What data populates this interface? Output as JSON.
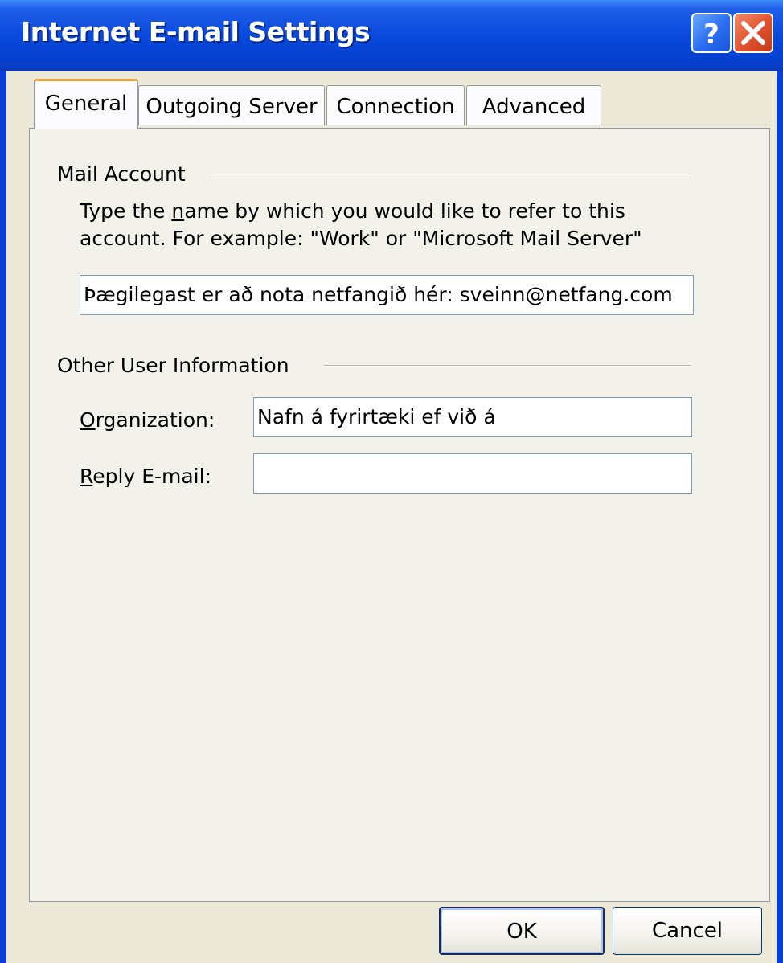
{
  "window": {
    "title": "Internet E-mail Settings",
    "help_icon": "question-mark-icon",
    "close_icon": "close-x-icon"
  },
  "tabs": [
    {
      "label": "General",
      "active": true
    },
    {
      "label": "Outgoing Server",
      "active": false
    },
    {
      "label": "Connection",
      "active": false
    },
    {
      "label": "Advanced",
      "active": false
    }
  ],
  "mail_account": {
    "group_title": "Mail Account",
    "description_line1_pre": "Type the ",
    "description_line1_accel": "n",
    "description_line1_post": "ame by which you would like to refer to this",
    "description_line2": "account.  For example: \"Work\" or \"Microsoft Mail Server\"",
    "account_name_value": "Þægilegast er að nota netfangið hér: sveinn@netfang.com"
  },
  "other_info": {
    "group_title": "Other User Information",
    "organization_label_accel": "O",
    "organization_label_rest": "rganization:",
    "organization_value": "Nafn á fyrirtæki ef við á",
    "reply_label_accel": "R",
    "reply_label_rest": "eply E-mail:",
    "reply_value": ""
  },
  "buttons": {
    "ok": "OK",
    "cancel": "Cancel"
  },
  "colors": {
    "titlebar": "#0a49dc",
    "dialog_face": "#ece9d8",
    "active_tab_accent": "#e8a33a"
  }
}
